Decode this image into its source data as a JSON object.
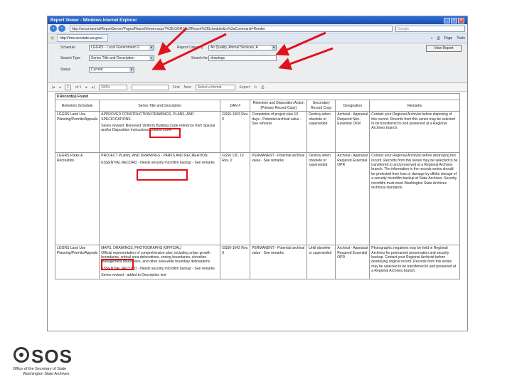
{
  "window": {
    "title": "Report Viewer - Windows Internet Explorer",
    "url": "http://secureportal/ReportServer/Pages/ReportViewer.aspx?%2fLGGRS%2fReport%2fSchedule&rs%3aCommand=Render",
    "search_placeholder": "Google",
    "tab_label": "http://rms.secstate.wa.gov/...",
    "tools": [
      "Page",
      "Tools"
    ]
  },
  "params": {
    "schedule_label": "Schedule",
    "schedule_value": "LGGRS - Local Government G",
    "report_category_label": "Report Category",
    "report_category_value": "Air Quality, Animal Services, A",
    "search_type_label": "Search Type",
    "search_type_value": "Series Title and Description",
    "search_for_label": "Search for",
    "search_for_value": "drawings",
    "status_label": "Status",
    "status_value": "Current",
    "view_report_label": "View Report"
  },
  "toolbar": {
    "page": "1",
    "of": "of 1",
    "zoom": "100%",
    "find_label": "Find",
    "next_label": "Next",
    "format": "Select a format",
    "export_label": "Export"
  },
  "report": {
    "found": "8 Record(s) Found",
    "headers": [
      "Retention Schedule",
      "Series Title and Description",
      "DAN #",
      "Retention and Disposition Action [Primary Record Copy]",
      "Secondary Record Copy",
      "Designation",
      "Remarks"
    ],
    "rows": [
      {
        "schedule": "LGGRS Land Use Planning/Permits/Appeals",
        "title_a": "APPROVED CONSTRUCTION DRAWINGS, PLANS, AND SPECIFICATIONS",
        "title_b": "Series revised: Removed 'Uniform Building Code reference from Special and/or Disposition Instructions Column 2004.",
        "dan": "GS50-1503 Rev. 0",
        "retention": "Completion of project plus 10 days - Potential archival value - See remarks",
        "secondary": "Destroy when obsolete or superseded",
        "designation": "Archival - Appraisal Required Non-Essential OFM",
        "remarks": "Contact your Regional Archivist before disposing of this record. Records from this series may be selected to be transferred to and preserved at a Regional Archives branch."
      },
      {
        "schedule": "LGGRS Parks & Recreation",
        "title_a": "PROJECT PLANS, AND DRAWINGS - PARKS AND RECREATION",
        "title_b": "ESSENTIAL RECORD - Needs security microfilm backup - See remarks",
        "dan": "GS50 13C 10 Rev. 0",
        "retention": "PERMANENT - Potential archival value - See remarks",
        "secondary": "Destroy when obsolete or superseded",
        "designation": "Archival - Appraisal Required Essential OPR",
        "remarks": "Contact your Regional Archivist before destroying this record. Records from this series may be selected to be transferred to and preserved at a Regional Archives branch. The information in the records series should be protected from loss or damage by offsite storage of a security microfilm backup at State Archives. Security microfilm must meet Washington State Archives technical standards."
      },
      {
        "schedule": "LGGRS Land Use Planning/Permits/Appeals",
        "title_a": "MAPS, DRAWINGS, PHOTOGRAPHS (OFFICIAL)",
        "title_b": "Official representation of comprehensive plan, including urban growth boundaries, critical area delineations, zoning boundaries, shoreline management boundaries, and other area-wide boundary delineations.",
        "title_c": "ESSENTIAL RECORD - Needs security microfilm backup - See remarks",
        "title_d": "Series revised - added to Description text",
        "dan": "GS50-1042 Rev. 0",
        "retention": "PERMANENT - Potential archival value - See remarks",
        "secondary": "Until obsolete or superseded",
        "designation": "Archival - Appraisal Required Essential OPR",
        "remarks": "Photographic negatives may be held in Regional Archives for permanent preservation and security backup. Contact your Regional Archivist before destroying original record. Records from this series may be selected to be transferred to and preserved at a Regional Archives branch."
      }
    ]
  },
  "logo": {
    "name": "SOS",
    "line1": "Office of the Secretary of State",
    "line2": "Washington State Archives"
  },
  "colors": {
    "highlight": "#e0121b",
    "titlebar": "#2f6fd6"
  }
}
